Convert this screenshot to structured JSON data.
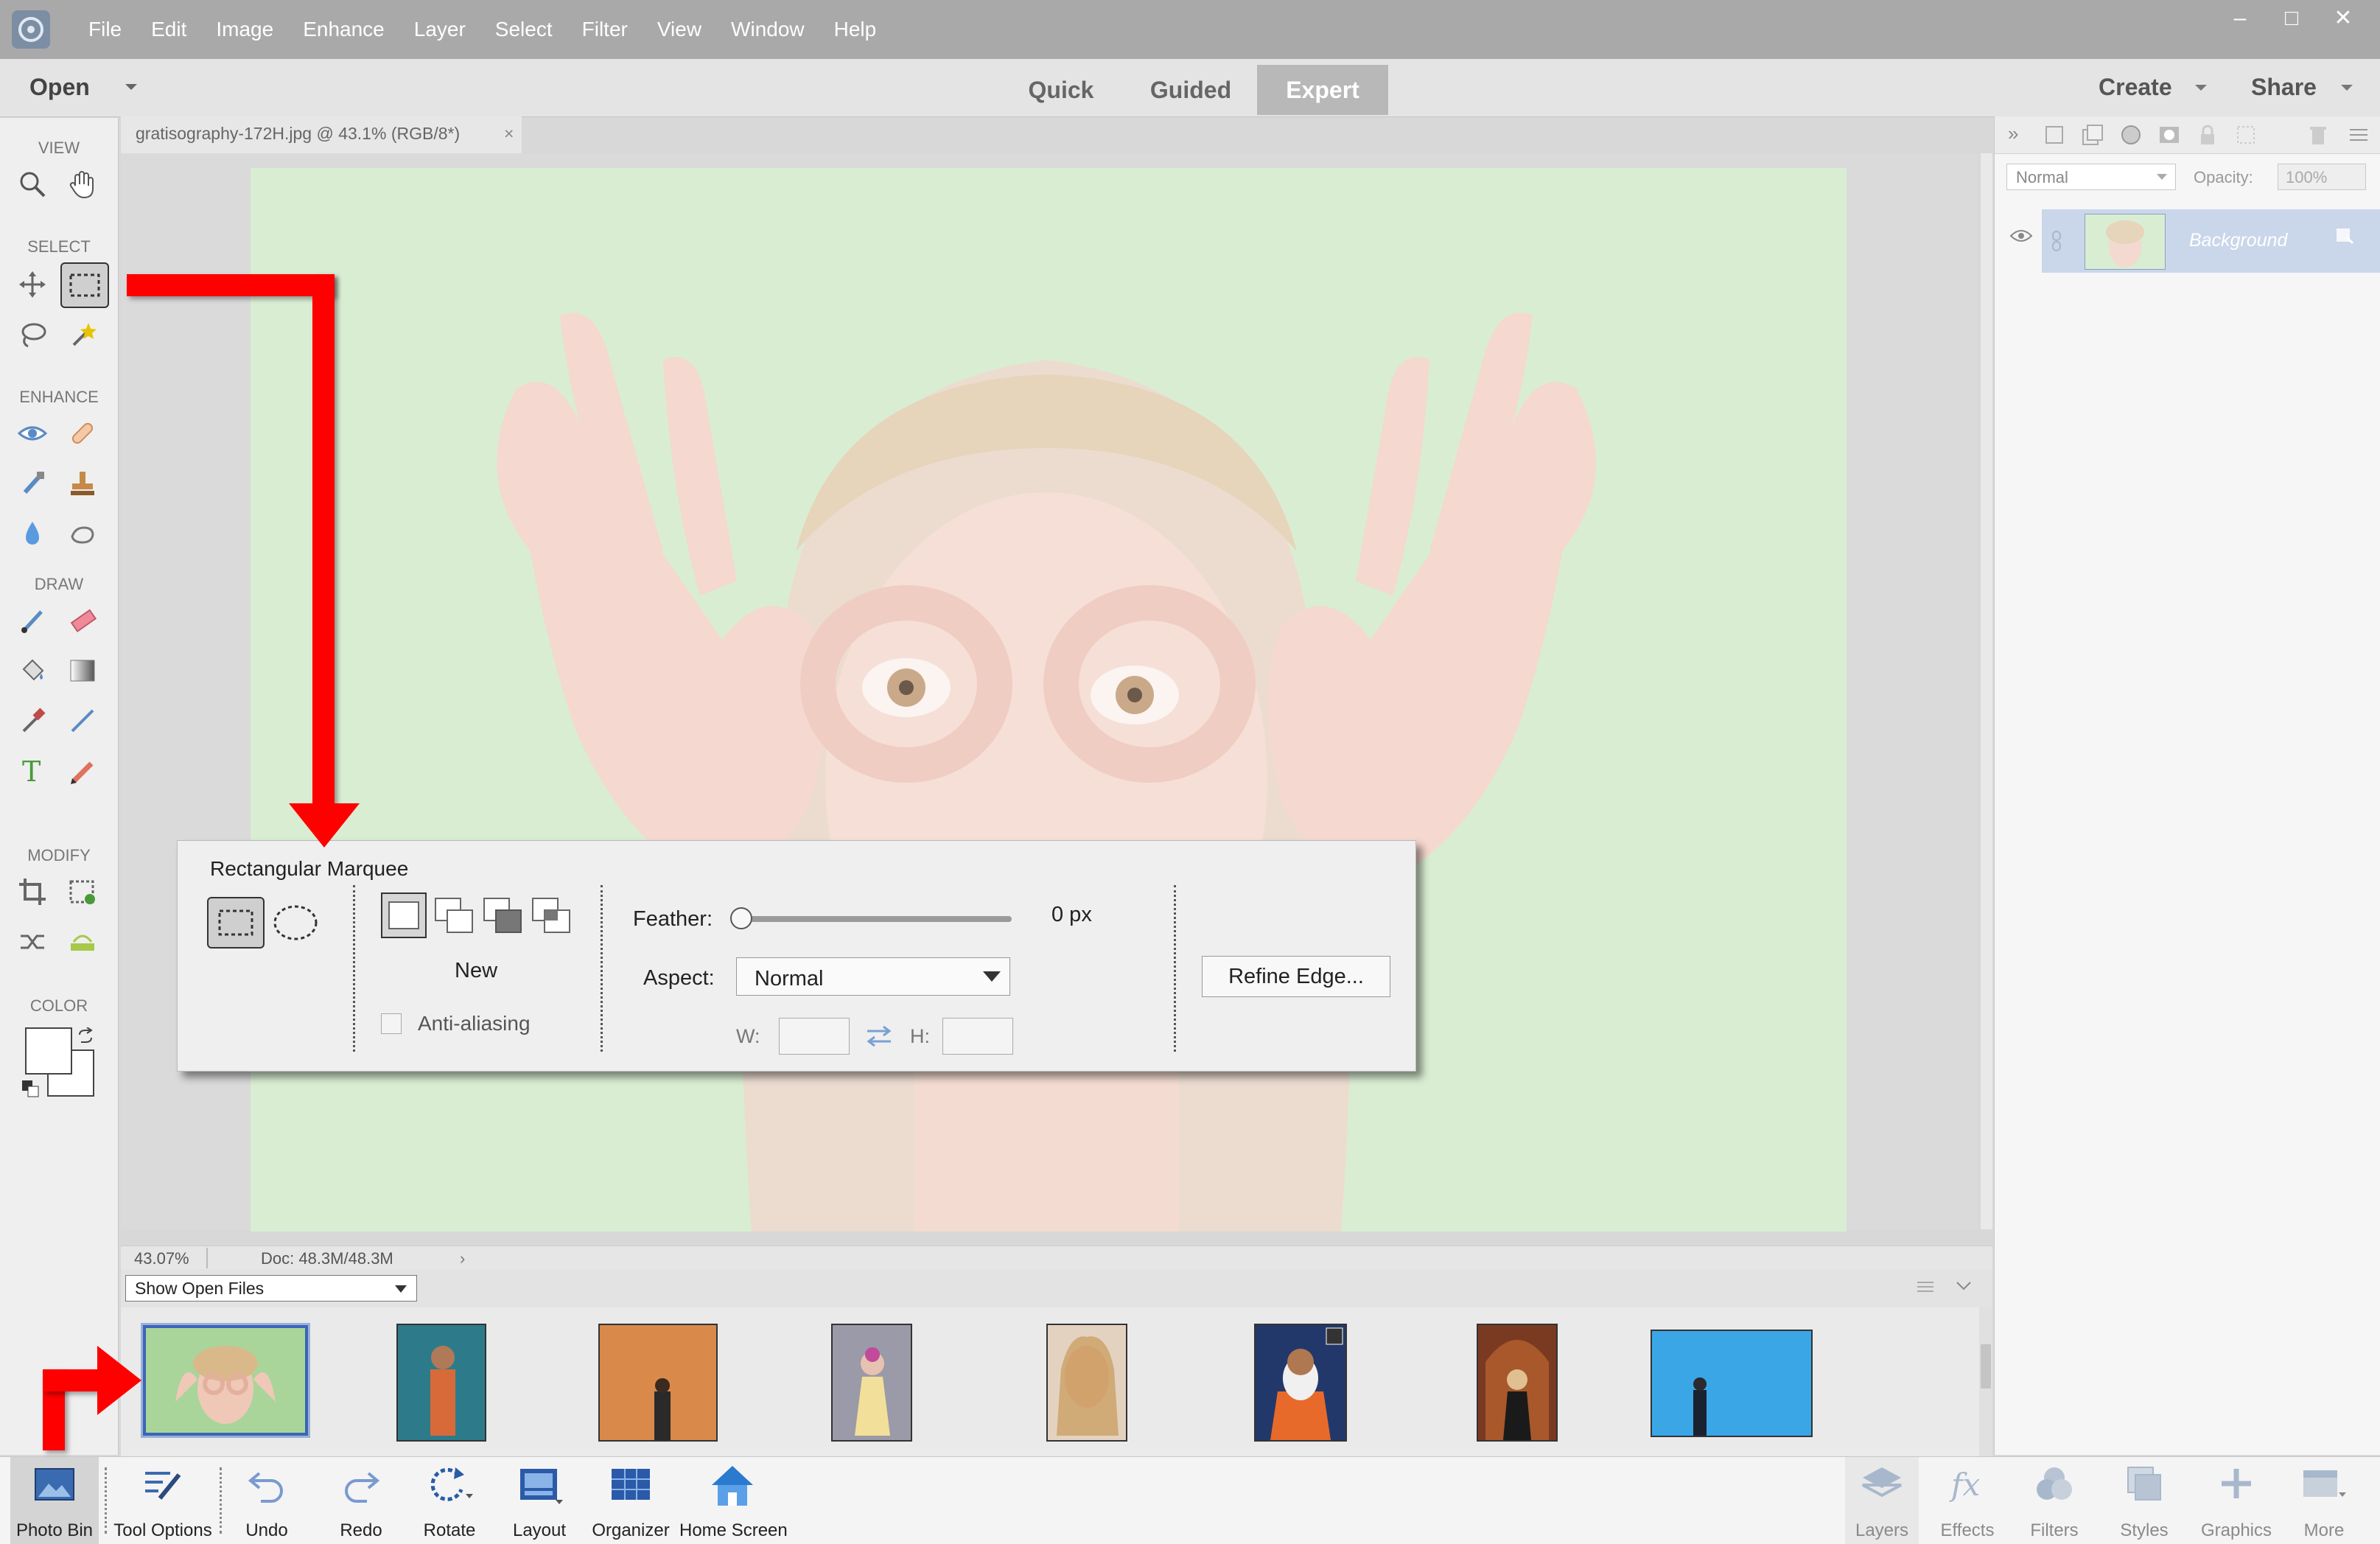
{
  "menu": [
    "File",
    "Edit",
    "Image",
    "Enhance",
    "Layer",
    "Select",
    "Filter",
    "View",
    "Window",
    "Help"
  ],
  "window_controls": [
    "–",
    "□",
    "✕"
  ],
  "modebar": {
    "open": "Open",
    "tabs": [
      "Quick",
      "Guided",
      "Expert"
    ],
    "active_tab": "Expert",
    "create": "Create",
    "share": "Share"
  },
  "toolbar": {
    "view": "VIEW",
    "select": "SELECT",
    "enhance": "ENHANCE",
    "draw": "DRAW",
    "modify": "MODIFY",
    "color": "COLOR"
  },
  "document": {
    "tab_title": "gratisography-172H.jpg @ 43.1% (RGB/8*)",
    "close": "×"
  },
  "status": {
    "zoom": "43.07%",
    "doc": "Doc: 48.3M/48.3M"
  },
  "layers_panel": {
    "blend_mode": "Normal",
    "opacity_label": "Opacity:",
    "opacity_value": "100%",
    "layer_name": "Background"
  },
  "tool_options": {
    "title": "Rectangular Marquee",
    "mode_label": "New",
    "anti_aliasing": "Anti-aliasing",
    "feather_label": "Feather:",
    "feather_value": "0 px",
    "feather_level": 0,
    "aspect_label": "Aspect:",
    "aspect_value": "Normal",
    "w_label": "W:",
    "h_label": "H:",
    "refine_edge": "Refine Edge..."
  },
  "photo_bin": {
    "filter": "Show Open Files"
  },
  "taskbar": {
    "left": [
      "Photo Bin",
      "Tool Options",
      "Undo",
      "Redo",
      "Rotate",
      "Layout",
      "Organizer",
      "Home Screen"
    ],
    "right": [
      "Layers",
      "Effects",
      "Filters",
      "Styles",
      "Graphics",
      "More"
    ]
  },
  "colors": {
    "accent": "#ff0000",
    "active_tab_bg": "#b8b8b8",
    "selected_layer": "#cad6ea",
    "selected_thumb_border": "#3a66b8"
  }
}
